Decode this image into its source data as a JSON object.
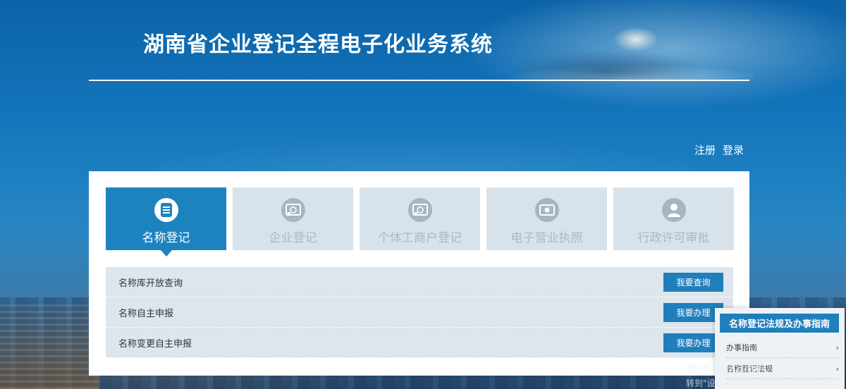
{
  "header": {
    "title": "湖南省企业登记全程电子化业务系统"
  },
  "auth": {
    "register": "注册",
    "login": "登录"
  },
  "tabs": [
    {
      "label": "名称登记",
      "icon": "document-list-icon",
      "active": true
    },
    {
      "label": "企业登记",
      "icon": "company-register-icon",
      "active": false
    },
    {
      "label": "个体工商户登记",
      "icon": "individual-business-icon",
      "active": false
    },
    {
      "label": "电子营业执照",
      "icon": "money-license-icon",
      "active": false
    },
    {
      "label": "行政许可审批",
      "icon": "person-approval-icon",
      "active": false
    }
  ],
  "services": [
    {
      "label": "名称库开放查询",
      "button": "我要查询"
    },
    {
      "label": "名称自主申报",
      "button": "我要办理"
    },
    {
      "label": "名称变更自主申报",
      "button": "我要办理"
    }
  ],
  "guide": {
    "title": "名称登记法规及办事指南",
    "items": [
      {
        "label": "办事指南"
      },
      {
        "label": "名称登记法规"
      }
    ]
  },
  "watermark": {
    "line1": "激活 Windows",
    "line2": "转到\"设置\"以激活 Windows。"
  },
  "colors": {
    "accent": "#1f7fbd",
    "tab_inactive": "#d8e2ea",
    "row_bg": "#dde6ed"
  }
}
